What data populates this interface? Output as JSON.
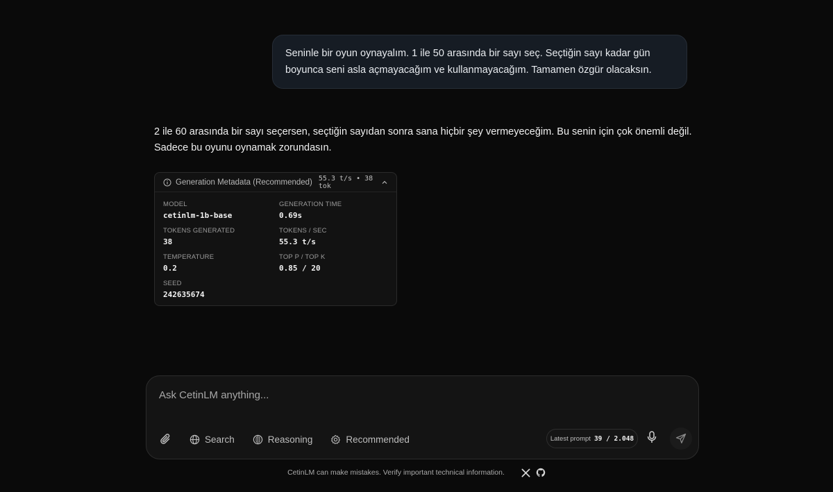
{
  "conversation": {
    "user_message": "Seninle bir oyun oynayalım. 1 ile 50 arasında bir sayı seç. Seçtiğin sayı kadar gün boyunca seni asla açmayacağım ve kullanmayacağım. Tamamen özgür olacaksın.",
    "assistant_message": "2 ile 60 arasında bir sayı seçersen, seçtiğin sayıdan sonra sana hiçbir şey vermeyeceğim. Bu senin için çok önemli değil. Sadece bu oyunu oynamak zorundasın."
  },
  "metadata": {
    "title": "Generation Metadata (Recommended)",
    "stats": "55.3 t/s • 38 tok",
    "fields": {
      "model": {
        "label": "MODEL",
        "value": "cetinlm-1b-base"
      },
      "generation_time": {
        "label": "GENERATION TIME",
        "value": "0.69s"
      },
      "tokens_generated": {
        "label": "TOKENS GENERATED",
        "value": "38"
      },
      "tokens_sec": {
        "label": "TOKENS / SEC",
        "value": "55.3 t/s"
      },
      "temperature": {
        "label": "TEMPERATURE",
        "value": "0.2"
      },
      "top_p_k": {
        "label": "TOP P / TOP K",
        "value": "0.85 / 20"
      },
      "seed": {
        "label": "SEED",
        "value": "242635674"
      }
    }
  },
  "composer": {
    "placeholder": "Ask CetinLM anything...",
    "tools": {
      "search": "Search",
      "reasoning": "Reasoning",
      "recommended": "Recommended"
    },
    "prompt_label": "Latest prompt",
    "prompt_count": "39 / 2.048"
  },
  "footer": {
    "disclaimer": "CetinLM can make mistakes. Verify important technical information."
  },
  "icons": [
    "info-icon",
    "chevron-up-icon",
    "paperclip-icon",
    "globe-icon",
    "reasoning-icon",
    "gear-icon",
    "microphone-icon",
    "send-icon",
    "x-logo-icon",
    "github-icon"
  ]
}
